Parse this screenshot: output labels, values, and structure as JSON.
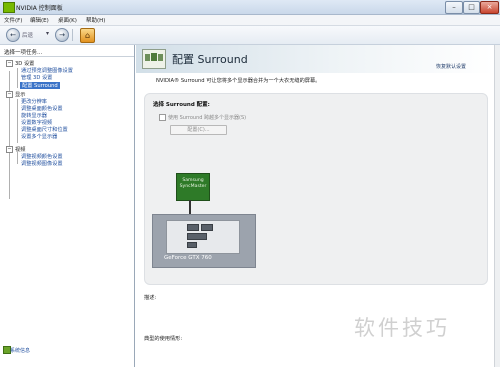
{
  "window": {
    "title": "NVIDIA 控制面板",
    "minimize": "–",
    "maximize": "□",
    "close": "×"
  },
  "menu": [
    "文件(F)",
    "编辑(E)",
    "桌面(K)",
    "帮助(H)"
  ],
  "toolbar": {
    "back_label": "后退",
    "dropdown": "▾",
    "forward": "→",
    "home": "⌂"
  },
  "sidebar": {
    "title": "选择一项任务...",
    "categories": [
      {
        "label": "3D 设置",
        "toggle": "−",
        "items": [
          "通过预览调整图像设置",
          "管理 3D 设置",
          "配置 Surround"
        ]
      },
      {
        "label": "显示",
        "toggle": "−",
        "items": [
          "更改分辨率",
          "调整桌面颜色设置",
          "旋转显示器",
          "设置数字视频",
          "调整桌面尺寸和位置",
          "设置多个显示器"
        ]
      },
      {
        "label": "视频",
        "toggle": "−",
        "items": [
          "调整视频颜色设置",
          "调整视频图像设置"
        ]
      }
    ],
    "selected": "配置 Surround",
    "system_info": "系统信息"
  },
  "main": {
    "title": "配置 Surround",
    "restore_defaults": "恢复默认设置",
    "description": "NVIDIA® Surround 可让您将多个显示器合并为一个大衣无缝的屏幕。",
    "panel": {
      "section_label": "选择 Surround 配置:",
      "checkbox_label": "使用 Surround 跨越多个显示器(S)",
      "configure_button": "配置(C)...",
      "monitor_label": "Samsung SyncMaster",
      "gpu_label": "GeForce GTX 760"
    },
    "description_label": "描述:",
    "usage_label": "典型的使用情形:"
  },
  "watermark": "软件技巧",
  "colors": {
    "nvidia_green": "#77b900",
    "selection": "#3a73c8",
    "link": "#1f4e9e"
  }
}
